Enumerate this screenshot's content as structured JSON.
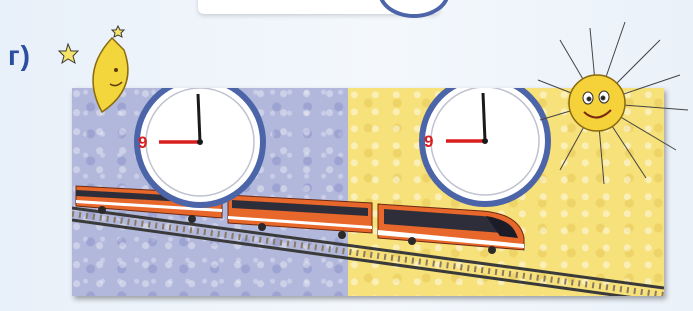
{
  "label": "г)",
  "clocks": [
    {
      "hour_label": "9"
    },
    {
      "hour_label": "9"
    }
  ],
  "icons": {
    "moon": "crescent-moon-icon",
    "sun": "smiling-sun-icon",
    "stars": "star-icon"
  },
  "colors": {
    "label": "#2b4fa0",
    "clock_ring": "#4c64a8",
    "hand_hour": "#d81e1e",
    "night_bg": "#b2b8dc",
    "day_bg": "#f6e17a",
    "train_body": "#e8672a"
  }
}
